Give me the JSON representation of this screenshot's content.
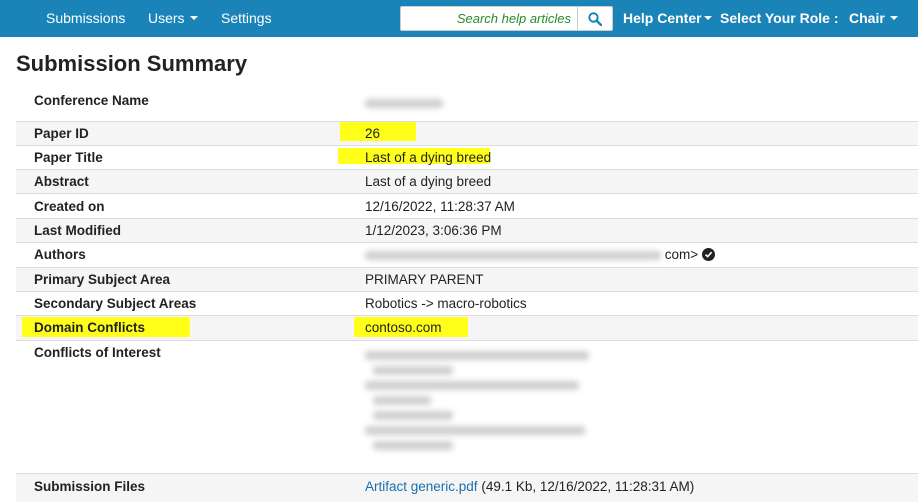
{
  "nav": {
    "submissions": "Submissions",
    "users": "Users",
    "settings": "Settings",
    "search_placeholder": "Search help articles",
    "help_center": "Help Center",
    "select_role": "Select Your Role :",
    "role": "Chair"
  },
  "page_title": "Submission Summary",
  "rows": {
    "conference_name": {
      "label": "Conference Name"
    },
    "paper_id": {
      "label": "Paper ID",
      "value": "26"
    },
    "paper_title": {
      "label": "Paper Title",
      "value": "Last of a dying breed"
    },
    "abstract": {
      "label": "Abstract",
      "value": "Last of a dying breed"
    },
    "created_on": {
      "label": "Created on",
      "value": "12/16/2022, 11:28:37 AM"
    },
    "last_modified": {
      "label": "Last Modified",
      "value": "1/12/2023, 3:06:36 PM"
    },
    "authors": {
      "label": "Authors",
      "value_suffix": "com>"
    },
    "primary_subject_area": {
      "label": "Primary Subject Area",
      "value": "PRIMARY PARENT"
    },
    "secondary_subject_areas": {
      "label": "Secondary Subject Areas",
      "value": "Robotics -> macro-robotics"
    },
    "domain_conflicts": {
      "label": "Domain Conflicts",
      "value": "contoso.com"
    },
    "conflicts_of_interest": {
      "label": "Conflicts of Interest"
    },
    "submission_files": {
      "label": "Submission Files",
      "file_name": "Artifact generic.pdf",
      "file_meta": "(49.1 Kb, 12/16/2022, 11:28:31 AM)"
    }
  },
  "colors": {
    "navbar": "#1a84b8",
    "highlight": "#ffff1a",
    "link": "#1a6fb0",
    "search_placeholder": "#2a8a2a"
  },
  "icons": [
    "search-icon",
    "checkmark-circle-icon",
    "chevron-down-icon"
  ]
}
